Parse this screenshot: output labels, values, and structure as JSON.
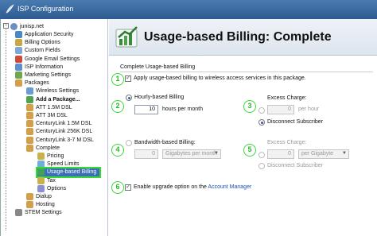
{
  "window": {
    "title": "ISP Configuration"
  },
  "tree": {
    "root": "junisp.net",
    "items": [
      {
        "label": "Application Security",
        "icon": "#4b86c9"
      },
      {
        "label": "Billing Options",
        "icon": "#c8a640"
      },
      {
        "label": "Custom Fields",
        "icon": "#7fa7d6"
      },
      {
        "label": "Google Email Settings",
        "icon": "#d04a3a"
      },
      {
        "label": "ISP Information",
        "icon": "#5b8fd0"
      },
      {
        "label": "Marketing Settings",
        "icon": "#6ea84b"
      },
      {
        "label": "Packages",
        "icon": "#d2a04a"
      },
      {
        "label": "Wireless Settings",
        "icon": "#6a9bd6"
      },
      {
        "label": "Add a Package...",
        "icon": "#4fa34f",
        "bold": true
      },
      {
        "label": "ATT 1.5M DSL",
        "icon": "#d2a04a"
      },
      {
        "label": "ATT 3M DSL",
        "icon": "#d2a04a"
      },
      {
        "label": "CenturyLink 1.5M DSL",
        "icon": "#d2a04a"
      },
      {
        "label": "CenturyLink 256K DSL",
        "icon": "#d2a04a"
      },
      {
        "label": "CenturyLink 3-7 M DSL",
        "icon": "#d2a04a"
      },
      {
        "label": "Complete",
        "icon": "#d2a04a"
      },
      {
        "label": "Pricing",
        "icon": "#c9b24a"
      },
      {
        "label": "Speed Limits",
        "icon": "#6fb0d8"
      },
      {
        "label": "Usage-based Billing",
        "icon": "#3fa35a",
        "selected": true
      },
      {
        "label": "Tax",
        "icon": "#c9b24a"
      },
      {
        "label": "Options",
        "icon": "#8a8fd0"
      },
      {
        "label": "Dialup",
        "icon": "#d2a04a"
      },
      {
        "label": "Hosting",
        "icon": "#d2a04a"
      },
      {
        "label": "STEM Settings",
        "icon": "#888888"
      }
    ]
  },
  "panel": {
    "heading": "Usage-based Billing: Complete",
    "section_title": "Complete Usage-based Billing",
    "apply_label": "Apply usage-based billing to wireless access services in this package.",
    "hourly": {
      "label": "Hourly-based Billing",
      "hours_value": "10",
      "hours_unit": "hours per month"
    },
    "excess1": {
      "label": "Excess Charge:",
      "amount_value": "0",
      "amount_unit": "per hour",
      "disconnect_label": "Disconnect Subscriber"
    },
    "bandwidth": {
      "label": "Bandwidth-based Billing:",
      "amount_value": "0",
      "unit_option": "Gigabytes per month"
    },
    "excess2": {
      "label": "Excess Charge:",
      "amount_value": "0",
      "unit_option": "per Gigabyte",
      "disconnect_label": "Disconnect Subscriber"
    },
    "upgrade_label": "Enable upgrade option on the",
    "upgrade_link": "Account Manager"
  },
  "markers": [
    "1",
    "2",
    "3",
    "4",
    "5",
    "6"
  ],
  "colors": {
    "marker_green": "#39d839",
    "titlebar": "#2d5b91",
    "selection": "#3a6fb3"
  }
}
